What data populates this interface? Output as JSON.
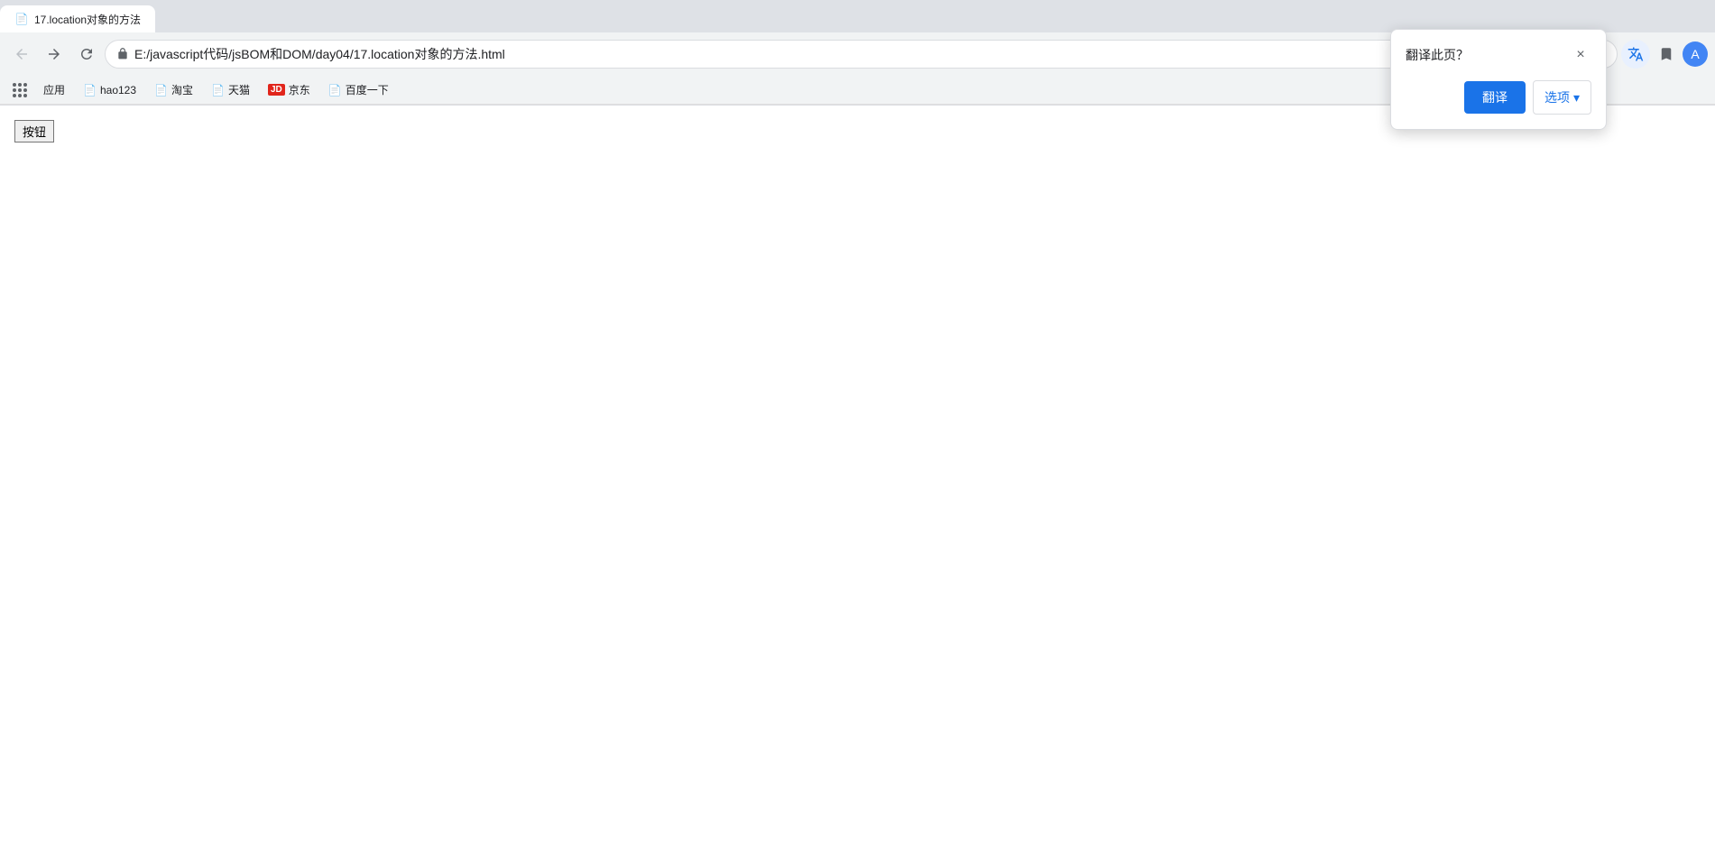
{
  "browser": {
    "tab": {
      "title": "17.location对象的方法",
      "favicon": "📄"
    },
    "address_bar": {
      "url": "E:/javascript代码/jsBOM和DOM/day04/17.location对象的方法.html",
      "lock_icon": "🔒"
    },
    "nav": {
      "back_label": "←",
      "forward_label": "→",
      "reload_label": "↻"
    }
  },
  "bookmarks": {
    "apps_label": "应用",
    "items": [
      {
        "id": "hao123",
        "label": "hao123",
        "icon": "📄"
      },
      {
        "id": "taobao",
        "label": "淘宝",
        "icon": "📄"
      },
      {
        "id": "tmall",
        "label": "天猫",
        "icon": "📄"
      },
      {
        "id": "jd",
        "label": "京东",
        "icon": "JD"
      },
      {
        "id": "baidu",
        "label": "百度一下",
        "icon": "📄"
      }
    ]
  },
  "page": {
    "button_label": "按钮"
  },
  "translate_popup": {
    "title": "翻译此页？",
    "translate_btn": "翻译",
    "options_btn": "选项",
    "close_icon": "×"
  }
}
